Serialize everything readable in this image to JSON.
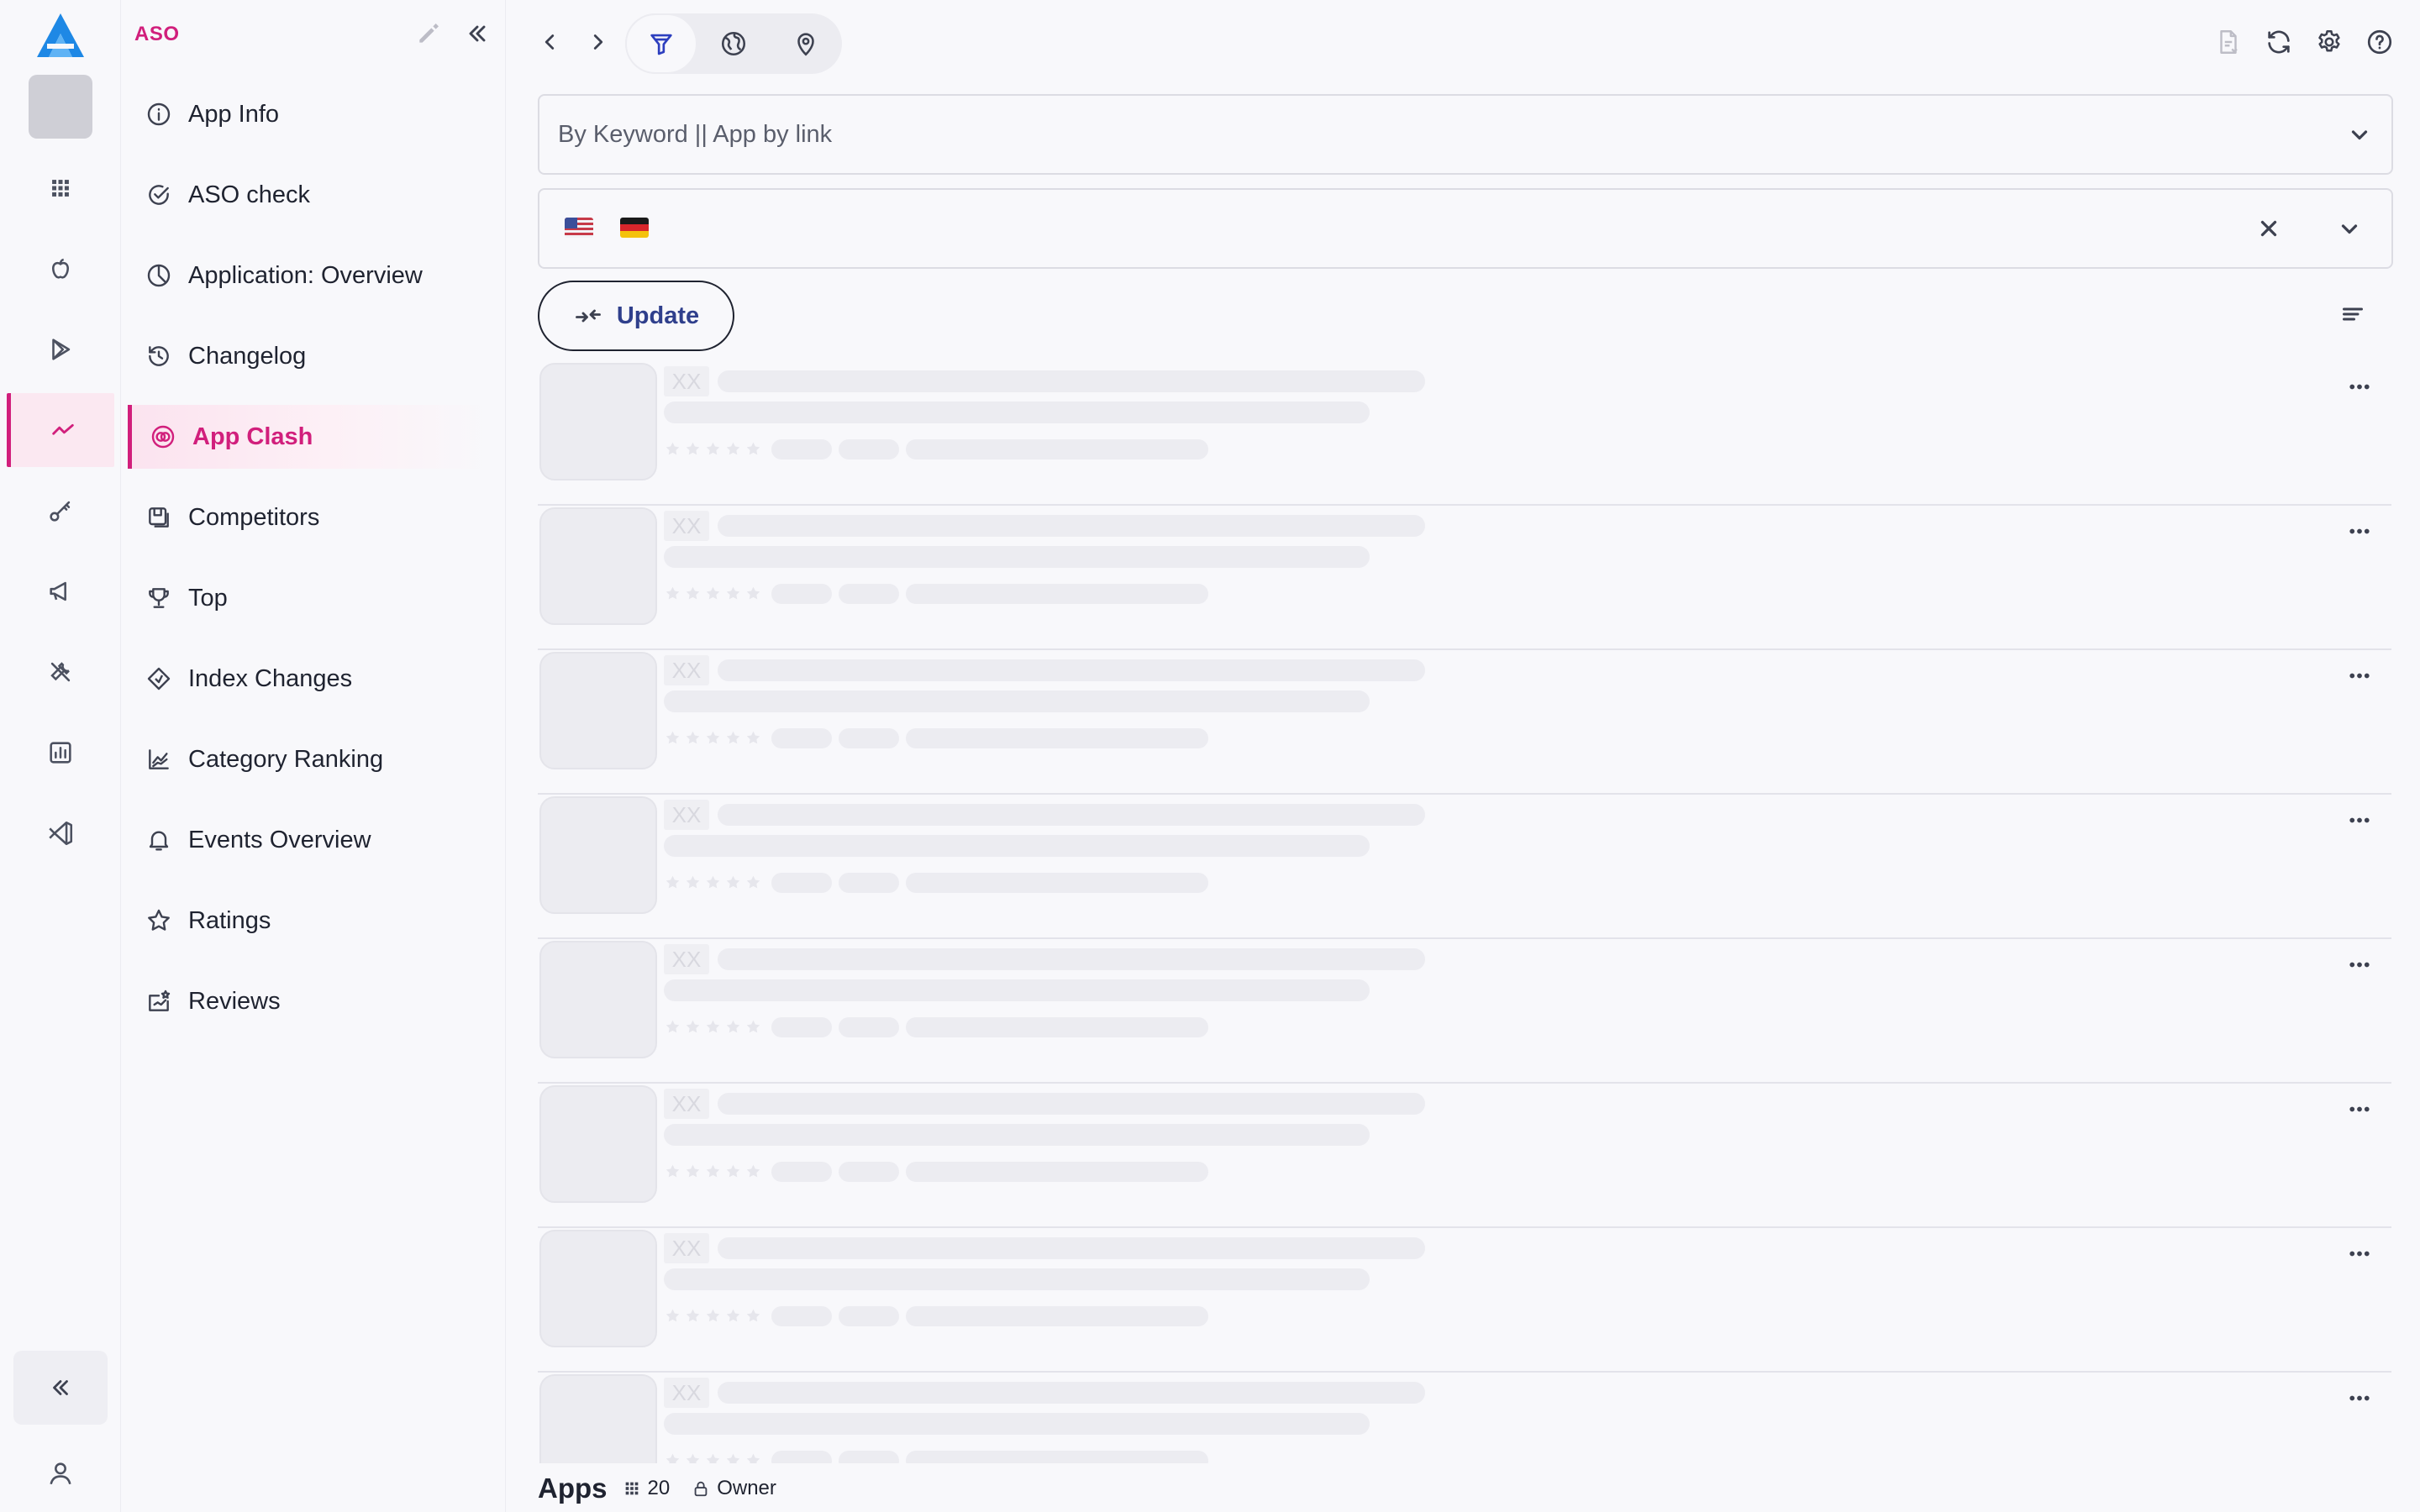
{
  "rail": {
    "items": [
      {
        "name": "rail-dashboard-grid",
        "icon": "grid-icon"
      },
      {
        "name": "rail-app-store",
        "icon": "apple-icon"
      },
      {
        "name": "rail-google-play",
        "icon": "play-icon"
      },
      {
        "name": "rail-aso",
        "icon": "trend-line-icon",
        "active": true
      },
      {
        "name": "rail-keywords",
        "icon": "key-icon"
      },
      {
        "name": "rail-ads",
        "icon": "megaphone-icon"
      },
      {
        "name": "rail-tools",
        "icon": "tools-icon"
      },
      {
        "name": "rail-reports",
        "icon": "bar-chart-icon"
      },
      {
        "name": "rail-integrations",
        "icon": "vscode-icon"
      }
    ]
  },
  "menu": {
    "title": "ASO",
    "items": [
      {
        "label": "App Info",
        "icon": "info-icon"
      },
      {
        "label": "ASO check",
        "icon": "check-circle-icon"
      },
      {
        "label": "Application: Overview",
        "icon": "pie-chart-icon"
      },
      {
        "label": "Changelog",
        "icon": "history-icon"
      },
      {
        "label": "App Clash",
        "icon": "clash-icon",
        "active": true
      },
      {
        "label": "Competitors",
        "icon": "competitors-icon"
      },
      {
        "label": "Top",
        "icon": "trophy-icon"
      },
      {
        "label": "Index Changes",
        "icon": "index-icon"
      },
      {
        "label": "Category Ranking",
        "icon": "line-chart-icon"
      },
      {
        "label": "Events Overview",
        "icon": "bell-icon"
      },
      {
        "label": "Ratings",
        "icon": "star-icon"
      },
      {
        "label": "Reviews",
        "icon": "reviews-icon"
      }
    ]
  },
  "toolbar": {
    "filter_buttons": [
      "filter-icon",
      "globe-icon",
      "map-pin-icon"
    ],
    "right_icons": [
      "export-doc-icon",
      "refresh-icon",
      "settings-icon",
      "help-icon"
    ]
  },
  "search": {
    "placeholder": "By Keyword || App by link",
    "value": ""
  },
  "countries": {
    "selected": [
      "US",
      "DE"
    ]
  },
  "update_button": {
    "label": "Update"
  },
  "list": {
    "skeleton_rows": 8,
    "placeholder_text": "XX"
  },
  "footer": {
    "title": "Apps",
    "count": "20",
    "owner_label": "Owner"
  },
  "colors": {
    "accent": "#d11f7c",
    "brand_blue": "#1e88e5",
    "skeleton": "#ececf1",
    "border": "#dcdce3"
  }
}
